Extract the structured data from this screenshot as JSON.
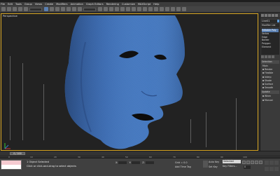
{
  "menu": [
    "File",
    "Edit",
    "Tools",
    "Group",
    "Views",
    "Create",
    "Modifiers",
    "Animation",
    "Graph Editors",
    "Rendering",
    "Customize",
    "MAXScript",
    "Help"
  ],
  "viewport": {
    "label": "Perspective",
    "mesh_color": "#4a7dc4",
    "border_color": "#d7a522"
  },
  "command_panel": {
    "object_name": "Line01",
    "modifier_list": "Modifier List",
    "stack": [
      "Editable Poly",
      "Vertex",
      "Edge",
      "Border",
      "Polygon",
      "Element"
    ],
    "selected_stack_index": 0,
    "rollout_top": "Selection",
    "rows": [
      "Main",
      "Render",
      "Flexible",
      "Interp",
      "Shade",
      "Surface",
      "Smooth"
    ],
    "extra_rows": [
      "Update",
      "When",
      "Manual"
    ]
  },
  "timeline": {
    "frame_label": "0 / 100",
    "ticks": [
      "0",
      "10",
      "20",
      "30",
      "40",
      "50",
      "60",
      "70",
      "80",
      "90",
      "100"
    ]
  },
  "status": {
    "selection": "1 Object Selected",
    "prompt": "Click or click-and-drag to select objects",
    "x_label": "X:",
    "y_label": "Y:",
    "z_label": "Z:",
    "grid": "Grid = 0.0",
    "add_time_tag": "Add Time Tag",
    "auto_key": "Auto Key",
    "set_key": "Set Key",
    "selected": "Selected",
    "key_filters": "Key Filters...",
    "frame": "0"
  }
}
